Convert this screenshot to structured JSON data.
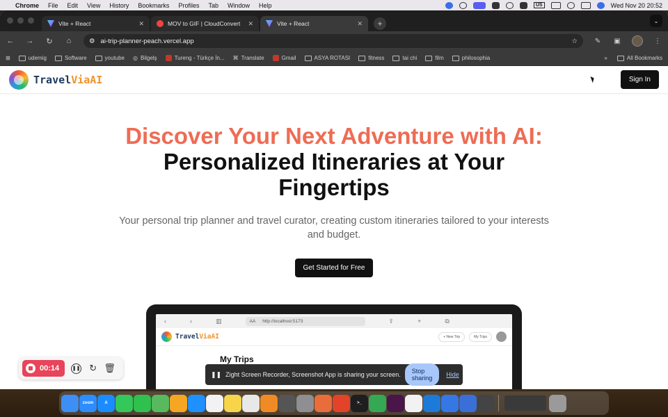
{
  "menubar": {
    "app_name": "Chrome",
    "menus": [
      "File",
      "Edit",
      "View",
      "History",
      "Bookmarks",
      "Profiles",
      "Tab",
      "Window",
      "Help"
    ],
    "input_source": "US",
    "clock": "Wed Nov 20  20:52"
  },
  "browser": {
    "tabs": [
      {
        "title": "Vite + React",
        "favicon": "vite-icon"
      },
      {
        "title": "MOV to GIF | CloudConvert",
        "favicon": "cloudconvert-icon"
      },
      {
        "title": "Vite + React",
        "favicon": "vite-icon"
      }
    ],
    "active_tab": 2,
    "url": "ai-trip-planner-peach.vercel.app",
    "bookmarks": [
      {
        "label": "udemig",
        "icon": "folder-icon"
      },
      {
        "label": "Software",
        "icon": "folder-icon"
      },
      {
        "label": "youtube",
        "icon": "folder-icon"
      },
      {
        "label": "Bilgelş",
        "icon": "globe-icon"
      },
      {
        "label": "Tureng - Türkçe İn...",
        "icon": "tureng-icon"
      },
      {
        "label": "Translate",
        "icon": "translate-icon"
      },
      {
        "label": "Gmail",
        "icon": "gmail-icon"
      },
      {
        "label": "ASYA ROTASI",
        "icon": "folder-icon"
      },
      {
        "label": "fitness",
        "icon": "folder-icon"
      },
      {
        "label": "tai chi",
        "icon": "folder-icon"
      },
      {
        "label": "film",
        "icon": "folder-icon"
      },
      {
        "label": "philosophia",
        "icon": "folder-icon"
      }
    ],
    "overflow_label": "»",
    "all_bookmarks": "All Bookmarks"
  },
  "site": {
    "logo_main": "Travel",
    "logo_accent": "ViaAI",
    "signin_label": "Sign In",
    "hero_line1": "Discover Your Next Adventure with AI:",
    "hero_line2": "Personalized Itineraries at Your Fingertips",
    "subtitle": "Your personal trip planner and travel curator, creating custom itineraries tailored to your interests and budget.",
    "cta_label": "Get Started for Free"
  },
  "mockup": {
    "url_prefix": "AA",
    "url": "http://localhost:5173",
    "logo_main": "Travel",
    "logo_accent": "ViaAI",
    "new_trip": "+ New Trip",
    "my_trips_btn": "My Trips",
    "page_title": "My Trips"
  },
  "recorder": {
    "elapsed": "00:14"
  },
  "sharing": {
    "message": "Zight Screen Recorder, Screenshot App is sharing your screen.",
    "stop_label": "Stop sharing",
    "hide_label": "Hide"
  },
  "dock": {
    "apps": [
      {
        "name": "finder-icon",
        "label": "",
        "color": "#3d8ff5"
      },
      {
        "name": "zoom-icon",
        "label": "zoom",
        "color": "#2d8cff"
      },
      {
        "name": "app-store-icon",
        "label": "A",
        "color": "#1a8cff"
      },
      {
        "name": "messages-icon",
        "label": "",
        "color": "#34c759"
      },
      {
        "name": "facetime-icon",
        "label": "",
        "color": "#30c04e"
      },
      {
        "name": "maps-icon",
        "label": "",
        "color": "#58b95f"
      },
      {
        "name": "photos-icon",
        "label": "",
        "color": "#f5a623"
      },
      {
        "name": "zoom-meetings-icon",
        "label": "",
        "color": "#1e90ff"
      },
      {
        "name": "reminders-icon",
        "label": "",
        "color": "#f2f2f2"
      },
      {
        "name": "notes-icon",
        "label": "",
        "color": "#f7d54a"
      },
      {
        "name": "textedit-icon",
        "label": "",
        "color": "#e8e8e8"
      },
      {
        "name": "books-icon",
        "label": "",
        "color": "#f08a24"
      },
      {
        "name": "calculator-icon",
        "label": "",
        "color": "#555555"
      },
      {
        "name": "system-settings-icon",
        "label": "",
        "color": "#8e8e93"
      },
      {
        "name": "launchpad-icon",
        "label": "",
        "color": "#e96d3a"
      },
      {
        "name": "gitlab-icon",
        "label": "",
        "color": "#e24329"
      },
      {
        "name": "terminal-icon",
        "label": ">_",
        "color": "#1e1e1e"
      },
      {
        "name": "chrome-icon",
        "label": "",
        "color": "#34a853"
      },
      {
        "name": "slack-icon",
        "label": "",
        "color": "#4a154b"
      },
      {
        "name": "mongodb-icon",
        "label": "",
        "color": "#f2f2f2"
      },
      {
        "name": "vscode-icon",
        "label": "",
        "color": "#1e7ad8"
      },
      {
        "name": "xcode-icon",
        "label": "",
        "color": "#3578e5"
      },
      {
        "name": "vmware-icon",
        "label": "",
        "color": "#3a6fd8"
      },
      {
        "name": "chatgpt-icon",
        "label": "",
        "color": "#444444"
      }
    ],
    "trash": "trash-icon"
  }
}
